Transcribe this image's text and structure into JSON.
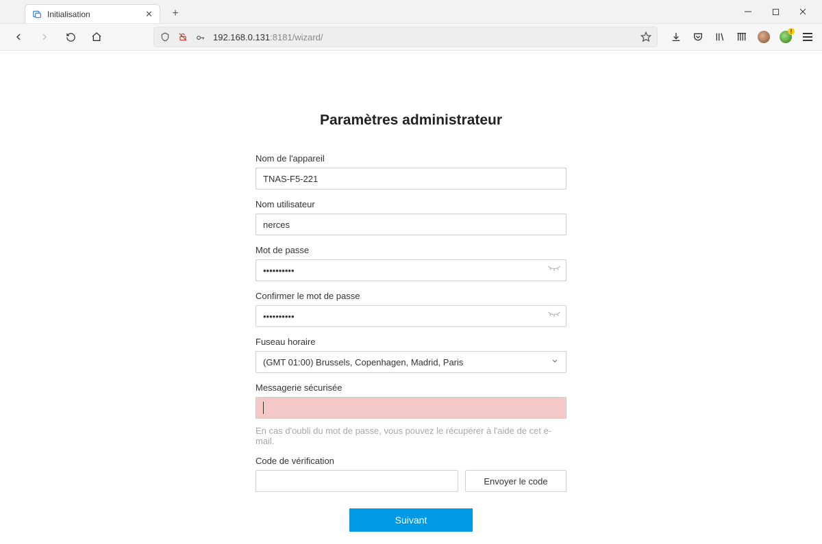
{
  "browser": {
    "tab_title": "Initialisation",
    "url_host": "192.168.0.131",
    "url_port_path": ":8181/wizard/"
  },
  "page": {
    "title": "Paramètres administrateur",
    "labels": {
      "device_name": "Nom de l'appareil",
      "username": "Nom utilisateur",
      "password": "Mot de passe",
      "confirm_password": "Confirmer le mot de passe",
      "timezone": "Fuseau horaire",
      "secure_email": "Messagerie sécurisée",
      "verification_code": "Code de vérification"
    },
    "values": {
      "device_name": "TNAS-F5-221",
      "username": "nerces",
      "password": "••••••••••",
      "confirm_password": "••••••••••",
      "timezone": "(GMT 01:00) Brussels, Copenhagen, Madrid, Paris",
      "secure_email": "",
      "verification_code": ""
    },
    "hint_email": "En cas d'oubli du mot de passe, vous pouvez le récupérer à l'aide de cet e-mail.",
    "buttons": {
      "send_code": "Envoyer le code",
      "next": "Suivant"
    }
  }
}
